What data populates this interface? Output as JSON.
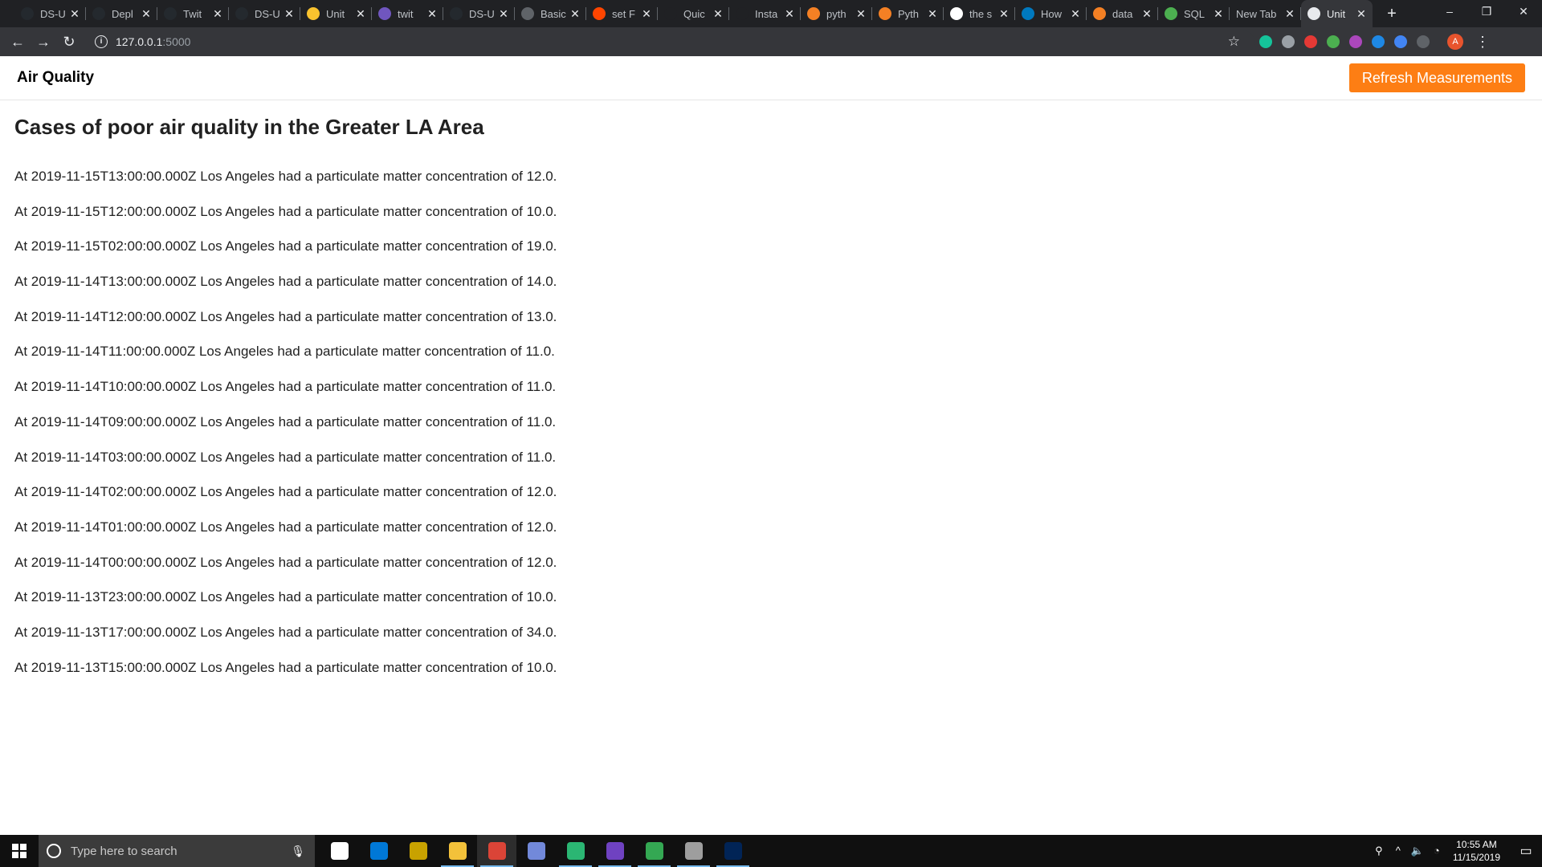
{
  "browser": {
    "tabs": [
      {
        "title": "DS-U",
        "favicon": "github-icon",
        "color": "#24292e"
      },
      {
        "title": "Depl",
        "favicon": "github-icon",
        "color": "#24292e"
      },
      {
        "title": "Twit",
        "favicon": "github-icon",
        "color": "#24292e"
      },
      {
        "title": "DS-U",
        "favicon": "github-icon",
        "color": "#24292e"
      },
      {
        "title": "Unit",
        "favicon": "smiley-icon",
        "color": "#f9c22e"
      },
      {
        "title": "twit",
        "favicon": "heroku-icon",
        "color": "#7056bf"
      },
      {
        "title": "DS-U",
        "favicon": "github-icon",
        "color": "#24292e"
      },
      {
        "title": "Basic",
        "favicon": "doc-icon",
        "color": "#5f6368"
      },
      {
        "title": "set F",
        "favicon": "reddit-icon",
        "color": "#ff4500"
      },
      {
        "title": "Quic",
        "favicon": "moon-icon",
        "color": "#202124"
      },
      {
        "title": "Insta",
        "favicon": "moon-icon",
        "color": "#202124"
      },
      {
        "title": "pyth",
        "favicon": "stackoverflow-icon",
        "color": "#f48024"
      },
      {
        "title": "Pyth",
        "favicon": "stackoverflow-icon",
        "color": "#f48024"
      },
      {
        "title": "the s",
        "favicon": "google-icon",
        "color": "#ffffff"
      },
      {
        "title": "How",
        "favicon": "trello-icon",
        "color": "#0079bf"
      },
      {
        "title": "data",
        "favicon": "stackoverflow-icon",
        "color": "#f48024"
      },
      {
        "title": "SQL",
        "favicon": "sql-icon",
        "color": "#4caf50"
      },
      {
        "title": "New Tab",
        "favicon": "",
        "color": ""
      },
      {
        "title": "Unit",
        "favicon": "globe-icon",
        "color": "#e8eaed"
      }
    ],
    "new_tab_symbol": "+",
    "window_controls": {
      "minimize": "–",
      "restore": "❐",
      "close": "✕"
    },
    "nav": {
      "back": "←",
      "forward": "→",
      "reload": "↻"
    },
    "url_host": "127.0.0.1",
    "url_port": ":5000",
    "bookmark_star": "☆",
    "extensions": [
      {
        "name": "grammarly-icon",
        "color": "#15c39a"
      },
      {
        "name": "puzzle-icon",
        "color": "#9aa0a6"
      },
      {
        "name": "adblock-icon",
        "color": "#e53935"
      },
      {
        "name": "green-ext-icon",
        "color": "#4caf50"
      },
      {
        "name": "color-wheel-icon",
        "color": "#ab47bc"
      },
      {
        "name": "doc-ext-icon",
        "color": "#1e88e5"
      },
      {
        "name": "translate-icon",
        "color": "#4285f4"
      },
      {
        "name": "dim-ext-icon",
        "color": "#5f6368"
      }
    ],
    "profile_initial": "A",
    "menu": "⋮"
  },
  "page": {
    "brand": "Air Quality",
    "refresh_button": "Refresh Measurements",
    "heading": "Cases of poor air quality in the Greater LA Area",
    "records": [
      "At 2019-11-15T13:00:00.000Z Los Angeles had a particulate matter concentration of 12.0.",
      "At 2019-11-15T12:00:00.000Z Los Angeles had a particulate matter concentration of 10.0.",
      "At 2019-11-15T02:00:00.000Z Los Angeles had a particulate matter concentration of 19.0.",
      "At 2019-11-14T13:00:00.000Z Los Angeles had a particulate matter concentration of 14.0.",
      "At 2019-11-14T12:00:00.000Z Los Angeles had a particulate matter concentration of 13.0.",
      "At 2019-11-14T11:00:00.000Z Los Angeles had a particulate matter concentration of 11.0.",
      "At 2019-11-14T10:00:00.000Z Los Angeles had a particulate matter concentration of 11.0.",
      "At 2019-11-14T09:00:00.000Z Los Angeles had a particulate matter concentration of 11.0.",
      "At 2019-11-14T03:00:00.000Z Los Angeles had a particulate matter concentration of 11.0.",
      "At 2019-11-14T02:00:00.000Z Los Angeles had a particulate matter concentration of 12.0.",
      "At 2019-11-14T01:00:00.000Z Los Angeles had a particulate matter concentration of 12.0.",
      "At 2019-11-14T00:00:00.000Z Los Angeles had a particulate matter concentration of 12.0.",
      "At 2019-11-13T23:00:00.000Z Los Angeles had a particulate matter concentration of 10.0.",
      "At 2019-11-13T17:00:00.000Z Los Angeles had a particulate matter concentration of 34.0.",
      "At 2019-11-13T15:00:00.000Z Los Angeles had a particulate matter concentration of 10.0."
    ]
  },
  "taskbar": {
    "search_placeholder": "Type here to search",
    "apps": [
      {
        "name": "task-view-icon",
        "color": "#ffffff",
        "running": false,
        "active": false
      },
      {
        "name": "store-icon",
        "color": "#0078d7",
        "running": false,
        "active": false
      },
      {
        "name": "app-yellow-icon",
        "color": "#c8a200",
        "running": false,
        "active": false
      },
      {
        "name": "file-explorer-icon",
        "color": "#f3c13a",
        "running": true,
        "active": false
      },
      {
        "name": "chrome-icon",
        "color": "#db4437",
        "running": true,
        "active": true
      },
      {
        "name": "discord-icon",
        "color": "#7289da",
        "running": false,
        "active": false
      },
      {
        "name": "app-multicolor-icon",
        "color": "#2bb673",
        "running": true,
        "active": false
      },
      {
        "name": "app-purple-icon",
        "color": "#6f42c1",
        "running": true,
        "active": false
      },
      {
        "name": "app-green-icon",
        "color": "#34a853",
        "running": true,
        "active": false
      },
      {
        "name": "app-gray-icon",
        "color": "#9e9e9e",
        "running": true,
        "active": false
      },
      {
        "name": "powershell-icon",
        "color": "#012456",
        "running": true,
        "active": false
      }
    ],
    "clock_time": "10:55 AM",
    "clock_date": "11/15/2019",
    "tray_icons": [
      "people-icon",
      "chevron-up-icon",
      "volume-icon",
      "wifi-icon"
    ],
    "tray_glyphs": [
      "⚲",
      "^",
      "🔈",
      "◔"
    ],
    "notification_glyph": "▭"
  }
}
